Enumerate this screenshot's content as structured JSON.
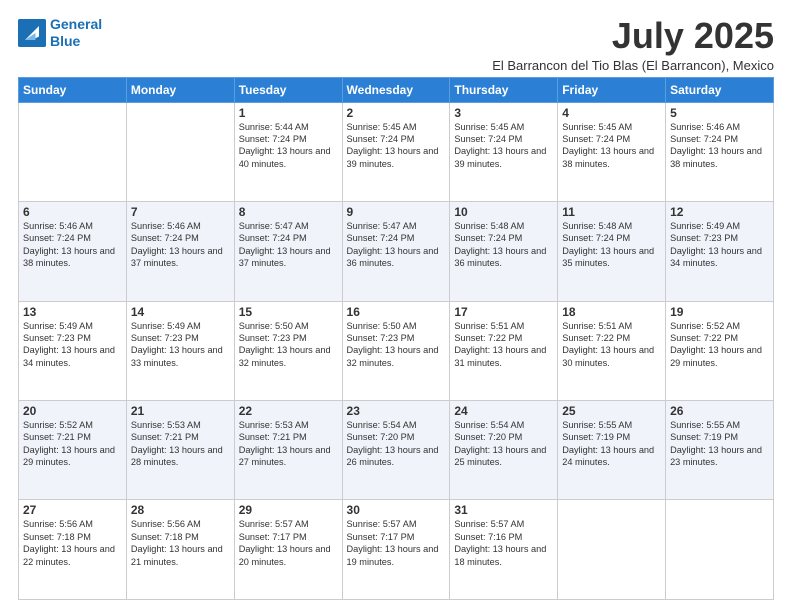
{
  "logo": {
    "line1": "General",
    "line2": "Blue"
  },
  "title": "July 2025",
  "subtitle": "El Barrancon del Tio Blas (El Barrancon), Mexico",
  "days": [
    "Sunday",
    "Monday",
    "Tuesday",
    "Wednesday",
    "Thursday",
    "Friday",
    "Saturday"
  ],
  "weeks": [
    [
      {
        "day": "",
        "sunrise": "",
        "sunset": "",
        "daylight": ""
      },
      {
        "day": "",
        "sunrise": "",
        "sunset": "",
        "daylight": ""
      },
      {
        "day": "1",
        "sunrise": "Sunrise: 5:44 AM",
        "sunset": "Sunset: 7:24 PM",
        "daylight": "Daylight: 13 hours and 40 minutes."
      },
      {
        "day": "2",
        "sunrise": "Sunrise: 5:45 AM",
        "sunset": "Sunset: 7:24 PM",
        "daylight": "Daylight: 13 hours and 39 minutes."
      },
      {
        "day": "3",
        "sunrise": "Sunrise: 5:45 AM",
        "sunset": "Sunset: 7:24 PM",
        "daylight": "Daylight: 13 hours and 39 minutes."
      },
      {
        "day": "4",
        "sunrise": "Sunrise: 5:45 AM",
        "sunset": "Sunset: 7:24 PM",
        "daylight": "Daylight: 13 hours and 38 minutes."
      },
      {
        "day": "5",
        "sunrise": "Sunrise: 5:46 AM",
        "sunset": "Sunset: 7:24 PM",
        "daylight": "Daylight: 13 hours and 38 minutes."
      }
    ],
    [
      {
        "day": "6",
        "sunrise": "Sunrise: 5:46 AM",
        "sunset": "Sunset: 7:24 PM",
        "daylight": "Daylight: 13 hours and 38 minutes."
      },
      {
        "day": "7",
        "sunrise": "Sunrise: 5:46 AM",
        "sunset": "Sunset: 7:24 PM",
        "daylight": "Daylight: 13 hours and 37 minutes."
      },
      {
        "day": "8",
        "sunrise": "Sunrise: 5:47 AM",
        "sunset": "Sunset: 7:24 PM",
        "daylight": "Daylight: 13 hours and 37 minutes."
      },
      {
        "day": "9",
        "sunrise": "Sunrise: 5:47 AM",
        "sunset": "Sunset: 7:24 PM",
        "daylight": "Daylight: 13 hours and 36 minutes."
      },
      {
        "day": "10",
        "sunrise": "Sunrise: 5:48 AM",
        "sunset": "Sunset: 7:24 PM",
        "daylight": "Daylight: 13 hours and 36 minutes."
      },
      {
        "day": "11",
        "sunrise": "Sunrise: 5:48 AM",
        "sunset": "Sunset: 7:24 PM",
        "daylight": "Daylight: 13 hours and 35 minutes."
      },
      {
        "day": "12",
        "sunrise": "Sunrise: 5:49 AM",
        "sunset": "Sunset: 7:23 PM",
        "daylight": "Daylight: 13 hours and 34 minutes."
      }
    ],
    [
      {
        "day": "13",
        "sunrise": "Sunrise: 5:49 AM",
        "sunset": "Sunset: 7:23 PM",
        "daylight": "Daylight: 13 hours and 34 minutes."
      },
      {
        "day": "14",
        "sunrise": "Sunrise: 5:49 AM",
        "sunset": "Sunset: 7:23 PM",
        "daylight": "Daylight: 13 hours and 33 minutes."
      },
      {
        "day": "15",
        "sunrise": "Sunrise: 5:50 AM",
        "sunset": "Sunset: 7:23 PM",
        "daylight": "Daylight: 13 hours and 32 minutes."
      },
      {
        "day": "16",
        "sunrise": "Sunrise: 5:50 AM",
        "sunset": "Sunset: 7:23 PM",
        "daylight": "Daylight: 13 hours and 32 minutes."
      },
      {
        "day": "17",
        "sunrise": "Sunrise: 5:51 AM",
        "sunset": "Sunset: 7:22 PM",
        "daylight": "Daylight: 13 hours and 31 minutes."
      },
      {
        "day": "18",
        "sunrise": "Sunrise: 5:51 AM",
        "sunset": "Sunset: 7:22 PM",
        "daylight": "Daylight: 13 hours and 30 minutes."
      },
      {
        "day": "19",
        "sunrise": "Sunrise: 5:52 AM",
        "sunset": "Sunset: 7:22 PM",
        "daylight": "Daylight: 13 hours and 29 minutes."
      }
    ],
    [
      {
        "day": "20",
        "sunrise": "Sunrise: 5:52 AM",
        "sunset": "Sunset: 7:21 PM",
        "daylight": "Daylight: 13 hours and 29 minutes."
      },
      {
        "day": "21",
        "sunrise": "Sunrise: 5:53 AM",
        "sunset": "Sunset: 7:21 PM",
        "daylight": "Daylight: 13 hours and 28 minutes."
      },
      {
        "day": "22",
        "sunrise": "Sunrise: 5:53 AM",
        "sunset": "Sunset: 7:21 PM",
        "daylight": "Daylight: 13 hours and 27 minutes."
      },
      {
        "day": "23",
        "sunrise": "Sunrise: 5:54 AM",
        "sunset": "Sunset: 7:20 PM",
        "daylight": "Daylight: 13 hours and 26 minutes."
      },
      {
        "day": "24",
        "sunrise": "Sunrise: 5:54 AM",
        "sunset": "Sunset: 7:20 PM",
        "daylight": "Daylight: 13 hours and 25 minutes."
      },
      {
        "day": "25",
        "sunrise": "Sunrise: 5:55 AM",
        "sunset": "Sunset: 7:19 PM",
        "daylight": "Daylight: 13 hours and 24 minutes."
      },
      {
        "day": "26",
        "sunrise": "Sunrise: 5:55 AM",
        "sunset": "Sunset: 7:19 PM",
        "daylight": "Daylight: 13 hours and 23 minutes."
      }
    ],
    [
      {
        "day": "27",
        "sunrise": "Sunrise: 5:56 AM",
        "sunset": "Sunset: 7:18 PM",
        "daylight": "Daylight: 13 hours and 22 minutes."
      },
      {
        "day": "28",
        "sunrise": "Sunrise: 5:56 AM",
        "sunset": "Sunset: 7:18 PM",
        "daylight": "Daylight: 13 hours and 21 minutes."
      },
      {
        "day": "29",
        "sunrise": "Sunrise: 5:57 AM",
        "sunset": "Sunset: 7:17 PM",
        "daylight": "Daylight: 13 hours and 20 minutes."
      },
      {
        "day": "30",
        "sunrise": "Sunrise: 5:57 AM",
        "sunset": "Sunset: 7:17 PM",
        "daylight": "Daylight: 13 hours and 19 minutes."
      },
      {
        "day": "31",
        "sunrise": "Sunrise: 5:57 AM",
        "sunset": "Sunset: 7:16 PM",
        "daylight": "Daylight: 13 hours and 18 minutes."
      },
      {
        "day": "",
        "sunrise": "",
        "sunset": "",
        "daylight": ""
      },
      {
        "day": "",
        "sunrise": "",
        "sunset": "",
        "daylight": ""
      }
    ]
  ]
}
